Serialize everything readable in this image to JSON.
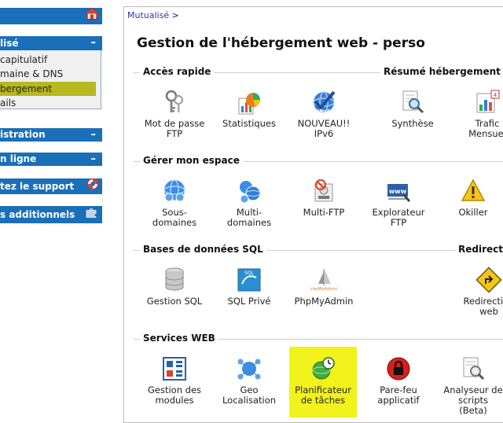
{
  "sidebar": {
    "mutualise_label": "lisé",
    "submenu": [
      "capitulatif",
      "maine & DNS",
      "bergement",
      "ails"
    ],
    "administration_label": "istration",
    "en_ligne_label": "n ligne",
    "support_label": "tez le support",
    "services_label": "s additionnels"
  },
  "main": {
    "breadcrumb_link": "Mutualisé",
    "breadcrumb_sep": ">",
    "title": "Gestion de l'hébergement web - perso",
    "sections": {
      "acces_rapide": "Accès rapide",
      "resume": "Résumé hébergement",
      "gerer": "Gérer mon espace",
      "sql": "Bases de données SQL",
      "redirection": "Redirection",
      "services": "Services WEB"
    },
    "tiles": {
      "password": [
        "Mot de passe",
        "FTP"
      ],
      "stats": [
        "Statistiques"
      ],
      "ipv6": [
        "NOUVEAU!!",
        "IPv6"
      ],
      "synthese": [
        "Synthèse"
      ],
      "trafic": [
        "Trafic",
        "Mensuel"
      ],
      "sous_domaines": [
        "Sous-",
        "domaines"
      ],
      "multi_domaines": [
        "Multi-",
        "domaines"
      ],
      "multi_ftp": [
        "Multi-FTP"
      ],
      "explorateur": [
        "Explorateur",
        "FTP"
      ],
      "okiller": [
        "Okiller"
      ],
      "gestion_sql": [
        "Gestion SQL"
      ],
      "sql_prive": [
        "SQL Privé"
      ],
      "phpmyadmin": [
        "PhpMyAdmin"
      ],
      "redirection_web": [
        "Redirection",
        "web"
      ],
      "modules": [
        "Gestion des",
        "modules"
      ],
      "geo": [
        "Geo",
        "Localisation"
      ],
      "planificateur": [
        "Planificateur",
        "de tâches"
      ],
      "parefeu": [
        "Pare-feu",
        "applicatif"
      ],
      "analyseur": [
        "Analyseur de",
        "scripts",
        "(Beta)"
      ]
    }
  },
  "colors": {
    "sidebar_blue": "#1a6fb8",
    "active_item": "#b8b820",
    "highlight": "#f2f21c"
  }
}
